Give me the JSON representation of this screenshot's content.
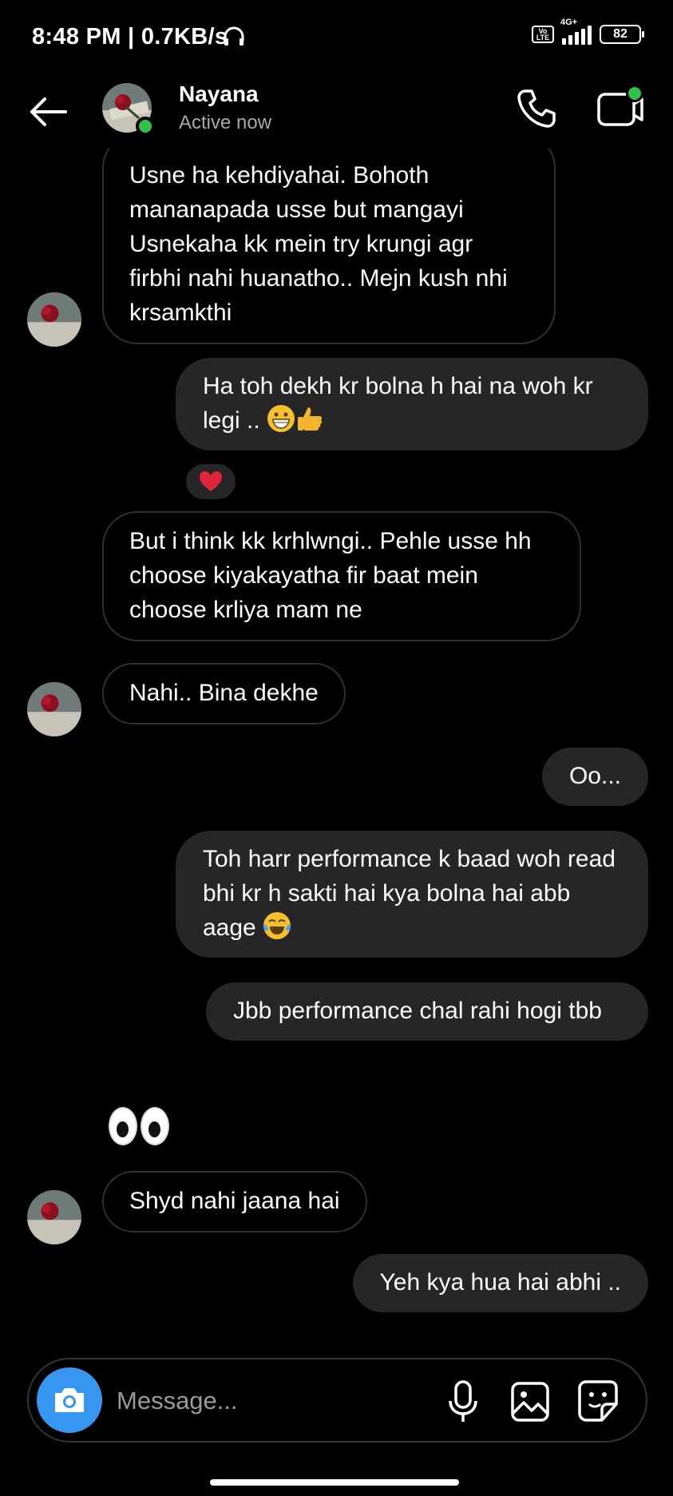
{
  "status_bar": {
    "time_speed": "8:48 PM | 0.7KB/s",
    "volte": "Vo LTE",
    "network": "4G+",
    "battery": "82"
  },
  "header": {
    "name": "Nayana",
    "status": "Active now"
  },
  "messages": [
    {
      "from": "them",
      "text": "Usne ha kehdiyahai. Bohoth mananapada usse  but mangayi Usnekaha kk mein try krungi agr firbhi nahi huanatho.. Mejn kush nhi krsamkthi"
    },
    {
      "from": "me",
      "text": "Ha toh dekh kr bolna h hai na woh kr legi ..",
      "emojis": [
        "grin-emoji",
        "thumbs-up-emoji"
      ],
      "reaction": "heart-emoji"
    },
    {
      "from": "them",
      "text": "But i think kk krhlwngi.. Pehle usse hh choose kiyakayatha fir baat mein choose krliya mam ne"
    },
    {
      "from": "them",
      "text": "Nahi.. Bina dekhe"
    },
    {
      "from": "me",
      "text": "Oo..."
    },
    {
      "from": "me",
      "text": "Toh harr performance k baad woh read bhi kr h sakti hai kya bolna hai abb aage",
      "emojis": [
        "tears-of-joy-emoji"
      ]
    },
    {
      "from": "me",
      "text": "Jbb performance chal rahi hogi tbb"
    },
    {
      "from": "them",
      "sticker": "eyes-emoji"
    },
    {
      "from": "them",
      "text": "Shyd nahi jaana hai"
    },
    {
      "from": "me",
      "text": "Yeh kya hua hai abhi .."
    }
  ],
  "composer": {
    "placeholder": "Message..."
  },
  "colors": {
    "online": "#2ec24d",
    "camera_button": "#3797f0",
    "outgoing_bubble": "#262626",
    "incoming_border": "#303030"
  }
}
